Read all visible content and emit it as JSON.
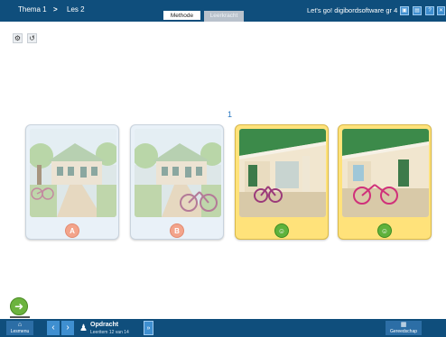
{
  "header": {
    "breadcrumb": {
      "theme": "Thema 1",
      "separator": ">",
      "lesson": "Les 2"
    },
    "tabs": [
      {
        "label": "Methode",
        "active": true
      },
      {
        "label": "Leerkracht",
        "active": false
      }
    ],
    "app_title": "Let's go! digibordsoftware gr 4",
    "window_buttons": [
      "display-icon",
      "monitor-icon",
      "help-icon",
      "close-icon"
    ]
  },
  "toolbar": {
    "settings_icon": "gear-icon",
    "undo_icon": "undo-icon"
  },
  "main": {
    "page_number": "1",
    "cards": [
      {
        "badge": "A",
        "highlighted": false,
        "scene": "house-with-bike-leaning-on-tree"
      },
      {
        "badge": "B",
        "highlighted": false,
        "scene": "house-with-bike-in-front"
      },
      {
        "badge": "",
        "highlighted": true,
        "scene": "bike-against-porch-wall",
        "icon": "smiley-icon"
      },
      {
        "badge": "",
        "highlighted": true,
        "scene": "bike-in-front-of-house",
        "icon": "smiley-icon"
      }
    ]
  },
  "footer": {
    "home_label": "Lesmenu",
    "assignment_title": "Opdracht",
    "assignment_sub": "Leeritem 12 van 14",
    "materials_label": "Gereedschap"
  },
  "colors": {
    "bar": "#0f4e7c",
    "button": "#3f8fd0",
    "highlight": "#ffe27a",
    "smile": "#5fb23c",
    "badge": "#f3a48b"
  }
}
